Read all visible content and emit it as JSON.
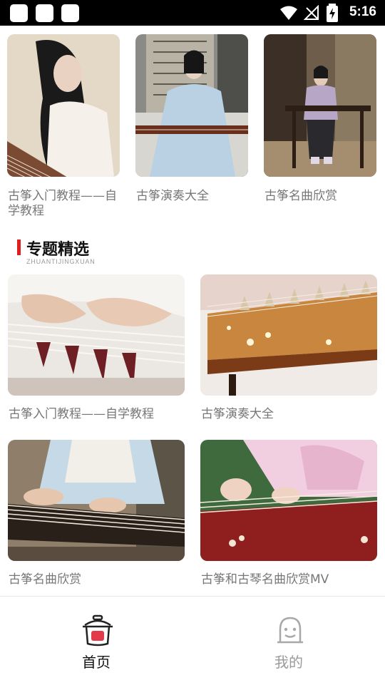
{
  "status_bar": {
    "time": "5:16"
  },
  "top_row": [
    {
      "caption": "古筝入门教程——自学教程",
      "image": "woman-in-white-playing-guzheng"
    },
    {
      "caption": "古筝演奏大全",
      "image": "woman-in-blue-dress-playing-guzheng"
    },
    {
      "caption": "古筝名曲欣赏",
      "image": "woman-at-guzheng-on-stand"
    }
  ],
  "section": {
    "title": "专题精选",
    "subtitle": "ZHUANTIJINGXUAN"
  },
  "featured": [
    {
      "caption": "古筝入门教程——自学教程",
      "image": "hands-on-guzheng-strings"
    },
    {
      "caption": "古筝演奏大全",
      "image": "guzheng-bridges-closeup"
    },
    {
      "caption": "古筝名曲欣赏",
      "image": "hands-playing-guzheng-blue-sleeves"
    },
    {
      "caption": "古筝和古琴名曲欣赏MV",
      "image": "hands-playing-guzheng-pink-sleeves"
    }
  ],
  "tabs": [
    {
      "label": "首页",
      "icon": "home-pot-icon",
      "active": true
    },
    {
      "label": "我的",
      "icon": "profile-face-icon",
      "active": false
    }
  ]
}
